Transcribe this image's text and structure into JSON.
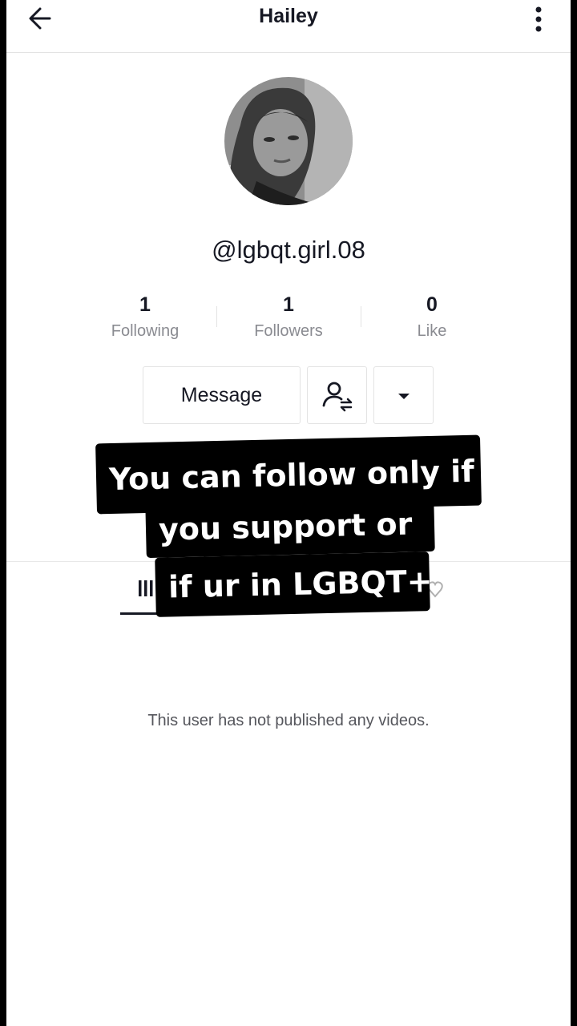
{
  "header": {
    "title": "Hailey"
  },
  "profile": {
    "handle": "@lgbqt.girl.08"
  },
  "stats": [
    {
      "value": "1",
      "label": "Following"
    },
    {
      "value": "1",
      "label": "Followers"
    },
    {
      "value": "0",
      "label": "Like"
    }
  ],
  "actions": {
    "message_label": "Message"
  },
  "empty_state": "This user has not published any videos.",
  "caption": {
    "line1": "You can follow only if",
    "line2": "you support or",
    "line3": "if ur in LGBQT+"
  }
}
